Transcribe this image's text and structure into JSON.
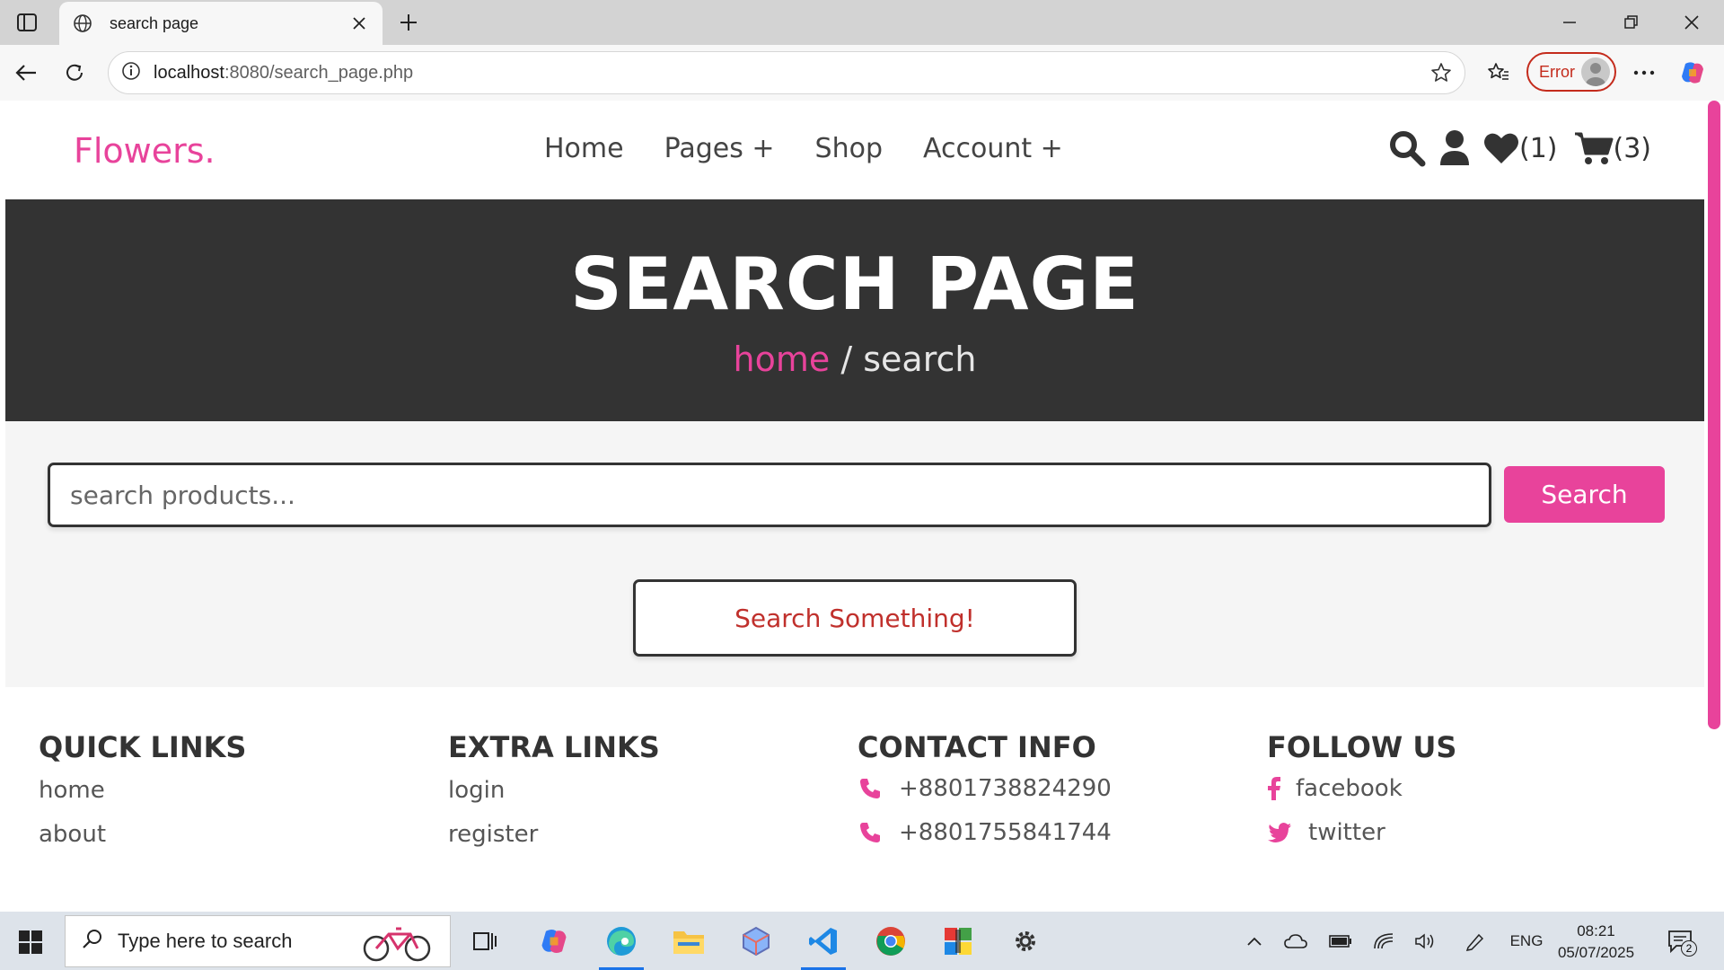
{
  "browser": {
    "tab_title": "search page",
    "url_host": "localhost",
    "url_path": ":8080/search_page.php",
    "profile_status": "Error"
  },
  "site": {
    "logo": "Flowers.",
    "nav": [
      "Home",
      "Pages +",
      "Shop",
      "Account +"
    ],
    "wishlist_count": "(1)",
    "cart_count": "(3)",
    "colors": {
      "accent": "#e8439b",
      "dark": "#333333"
    }
  },
  "hero": {
    "title": "SEARCH PAGE",
    "crumb_home": "home",
    "crumb_sep": " / ",
    "crumb_current": "search"
  },
  "search": {
    "placeholder": "search products...",
    "value": "",
    "button_label": "Search",
    "empty_message": "Search Something!"
  },
  "footer": {
    "quick_links": {
      "heading": "QUICK LINKS",
      "items": [
        "home",
        "about"
      ]
    },
    "extra_links": {
      "heading": "EXTRA LINKS",
      "items": [
        "login",
        "register"
      ]
    },
    "contact_info": {
      "heading": "CONTACT INFO",
      "items": [
        "+8801738824290",
        "+8801755841744"
      ]
    },
    "follow_us": {
      "heading": "FOLLOW US",
      "items": [
        "facebook",
        "twitter"
      ]
    }
  },
  "taskbar": {
    "search_placeholder": "Type here to search",
    "language": "ENG",
    "time": "08:21",
    "date": "05/07/2025",
    "notifications": "2"
  }
}
